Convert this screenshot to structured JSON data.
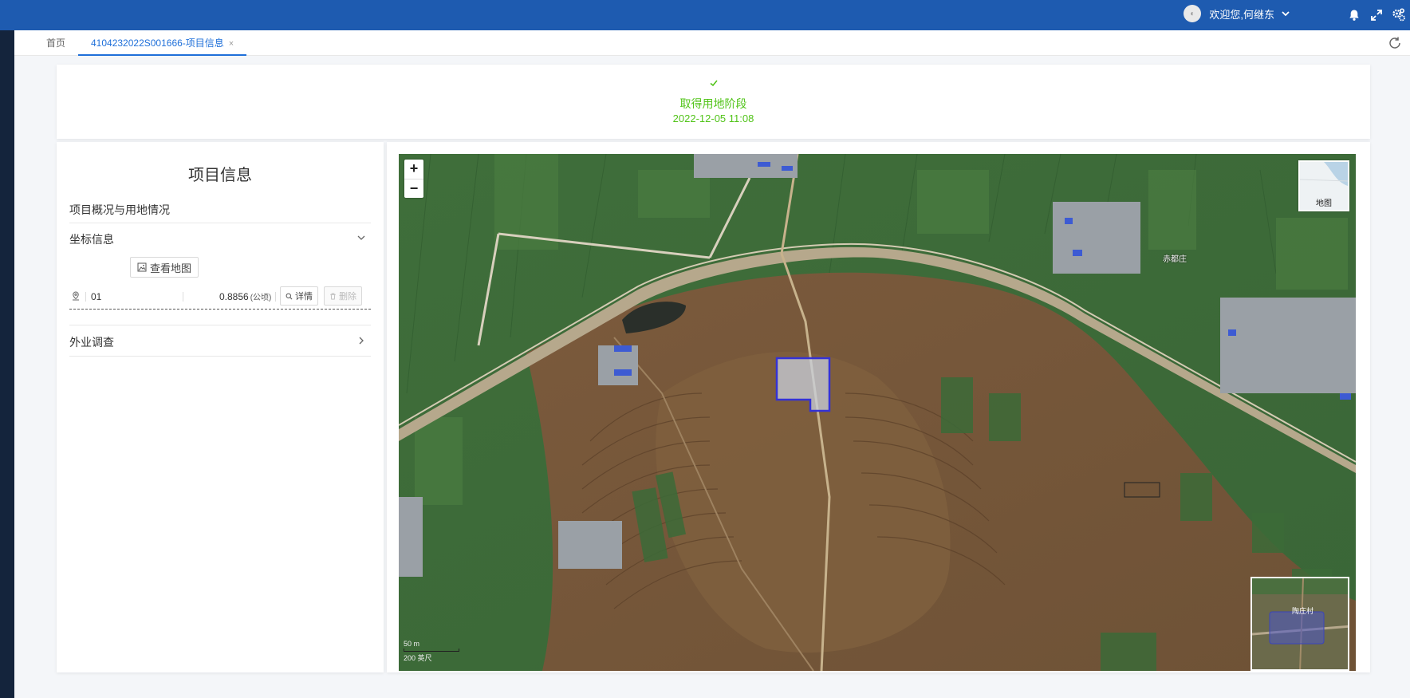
{
  "header": {
    "user_greeting": "欢迎您,何继东",
    "colors": {
      "topbar": "#1e5bb0",
      "sidebar": "#14243c",
      "accent": "#1e6fd9",
      "success": "#52c41a"
    },
    "icons": [
      "avatar",
      "chevron-down-icon",
      "bell-icon",
      "fullscreen-icon",
      "settings-icon"
    ]
  },
  "tabs": {
    "home": "首页",
    "active": "4104232022S001666-项目信息",
    "close": "×"
  },
  "status": {
    "stage": "取得用地阶段",
    "time": "2022-12-05 11:08"
  },
  "project": {
    "title": "项目信息",
    "subtitle": "项目概况与用地情况",
    "coord_section": "坐标信息",
    "view_map": "查看地图",
    "parcel": {
      "code": "01",
      "area": "0.8856",
      "unit": "(公顷)",
      "detail": "详情",
      "delete": "删除"
    },
    "field_survey": "外业调查"
  },
  "map": {
    "zoom_in": "+",
    "zoom_out": "−",
    "layer_label": "地图",
    "place_label": "赤都庄",
    "overview_label": "陶庄村",
    "scale_top": "50 m",
    "scale_bottom": "200 英尺"
  }
}
